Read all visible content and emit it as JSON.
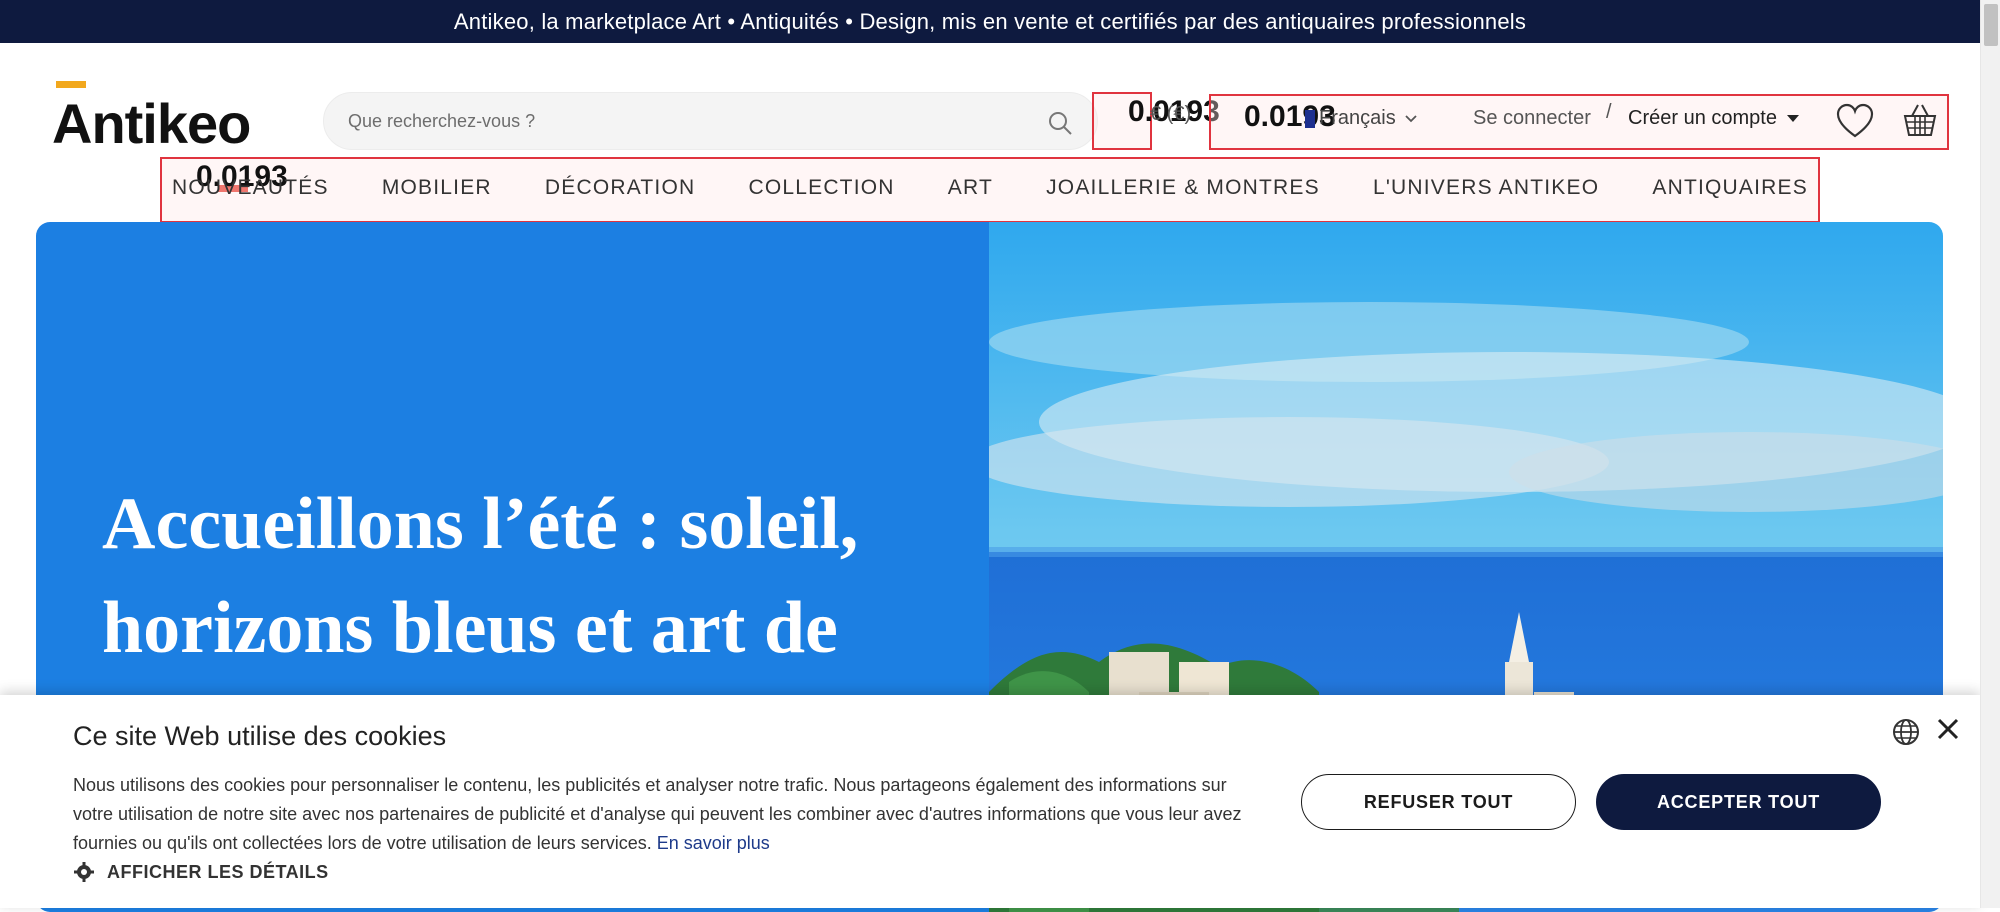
{
  "topbar": {
    "text": "Antikeo, la marketplace Art • Antiquités • Design, mis en vente et certifiés par des antiquaires professionnels"
  },
  "header": {
    "logo_text": "Antikeo",
    "search_placeholder": "Que recherchez-vous ?",
    "currency": "€ (€)",
    "language": "Français",
    "login": "Se connecter",
    "separator": "/",
    "create_account": "Créer un compte"
  },
  "annotations": {
    "label_1": "0.0193",
    "label_2": "0.0193",
    "label_3": "0.0193"
  },
  "nav": {
    "items": [
      "NOUVEAUTÉS",
      "MOBILIER",
      "DÉCORATION",
      "COLLECTION",
      "ART",
      "JOAILLERIE & MONTRES",
      "L'UNIVERS ANTIKEO",
      "ANTIQUAIRES"
    ]
  },
  "hero": {
    "title": "Accueillons l’été : soleil, horizons bleus et art de"
  },
  "cookie": {
    "title": "Ce site Web utilise des cookies",
    "body": "Nous utilisons des cookies pour personnaliser le contenu, les publicités et analyser notre trafic. Nous partageons également des informations sur votre utilisation de notre site avec nos partenaires de publicité et d'analyse qui peuvent les combiner avec d'autres informations que vous leur avez fournies ou qu'ils ont collectées lors de votre utilisation de leurs services.",
    "learn_more": "En savoir plus",
    "details": "AFFICHER LES DÉTAILS",
    "refuse": "REFUSER TOUT",
    "accept": "ACCEPTER TOUT"
  },
  "colors": {
    "topbar_bg": "#0e1a3f",
    "hero_blue": "#1c7fe2",
    "accent_yellow": "#f2a81d",
    "accent_red": "#e63b2e",
    "annotation_red": "#e0343f"
  }
}
